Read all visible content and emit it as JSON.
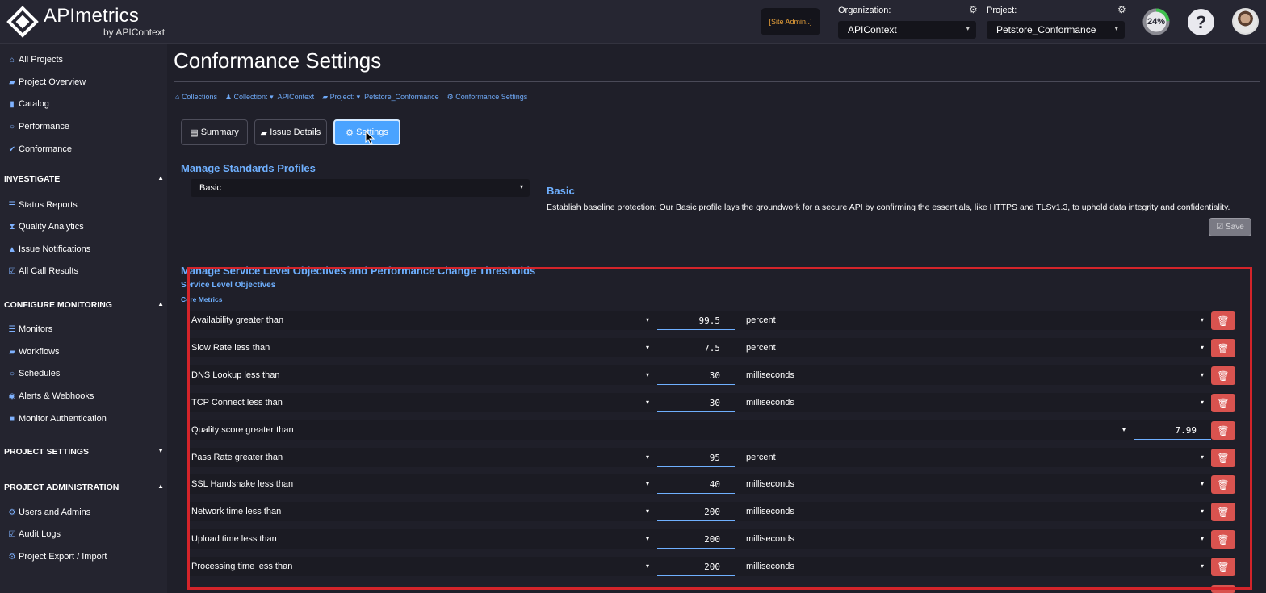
{
  "header": {
    "logo_title": "APImetrics",
    "logo_sub": "by APIContext",
    "site_admin": "[Site Admin..]",
    "org_label": "Organization:",
    "org_value": "APIContext",
    "project_label": "Project:",
    "project_value": "Petstore_Conformance",
    "progress": "24%",
    "help": "?"
  },
  "sidebar": {
    "top_items": [
      {
        "label": "All Projects",
        "icon": "home-icon"
      },
      {
        "label": "Project Overview",
        "icon": "folder-open-icon"
      },
      {
        "label": "Catalog",
        "icon": "book-icon"
      },
      {
        "label": "Performance",
        "icon": "clock-icon"
      },
      {
        "label": "Conformance",
        "icon": "check-icon"
      }
    ],
    "investigate": {
      "heading": "INVESTIGATE",
      "items": [
        {
          "label": "Status Reports",
          "icon": "list-icon"
        },
        {
          "label": "Quality Analytics",
          "icon": "hourglass-icon"
        },
        {
          "label": "Issue Notifications",
          "icon": "bell-icon"
        },
        {
          "label": "All Call Results",
          "icon": "checkbox-icon"
        }
      ]
    },
    "configure": {
      "heading": "CONFIGURE MONITORING",
      "items": [
        {
          "label": "Monitors",
          "icon": "list-icon"
        },
        {
          "label": "Workflows",
          "icon": "folder-icon"
        },
        {
          "label": "Schedules",
          "icon": "clock-icon"
        },
        {
          "label": "Alerts & Webhooks",
          "icon": "globe-icon"
        },
        {
          "label": "Monitor Authentication",
          "icon": "lock-icon"
        }
      ]
    },
    "project_settings": {
      "heading": "PROJECT SETTINGS"
    },
    "administration": {
      "heading": "PROJECT ADMINISTRATION",
      "items": [
        {
          "label": "Users and Admins",
          "icon": "gear-icon"
        },
        {
          "label": "Audit Logs",
          "icon": "checkbox-icon"
        },
        {
          "label": "Project Export / Import",
          "icon": "gear-icon"
        }
      ]
    }
  },
  "main": {
    "title": "Conformance Settings",
    "breadcrumb": [
      "Collections",
      "Collection:",
      "APIContext",
      "Project:",
      "Petstore_Conformance",
      "Conformance Settings"
    ],
    "tabs": [
      "Summary",
      "Issue Details",
      "Settings"
    ],
    "standards": {
      "heading": "Manage Standards Profiles",
      "selected": "Basic",
      "profile_title": "Basic",
      "profile_desc": "Establish baseline protection: Our Basic profile lays the groundwork for a secure API by confirming the essentials, like HTTPS and TLSv1.3, to uphold data integrity and confidentiality.",
      "save_label": "Save"
    },
    "slo": {
      "heading": "Manage Service Level Objectives and Performance Change Thresholds",
      "subheading": "Service Level Objectives",
      "core_label": "Core Metrics",
      "rows": [
        {
          "label": "Availability greater than",
          "value": "99.5",
          "unit": "percent"
        },
        {
          "label": "Slow Rate less than",
          "value": "7.5",
          "unit": "percent"
        },
        {
          "label": "DNS Lookup less than",
          "value": "30",
          "unit": "milliseconds"
        },
        {
          "label": "TCP Connect less than",
          "value": "30",
          "unit": "milliseconds"
        },
        {
          "label": "Quality score greater than",
          "value": "7.99",
          "unit": ""
        },
        {
          "label": "Pass Rate greater than",
          "value": "95",
          "unit": "percent"
        },
        {
          "label": "SSL Handshake less than",
          "value": "40",
          "unit": "milliseconds"
        },
        {
          "label": "Network time less than",
          "value": "200",
          "unit": "milliseconds"
        },
        {
          "label": "Upload time less than",
          "value": "200",
          "unit": "milliseconds"
        },
        {
          "label": "Processing time less than",
          "value": "200",
          "unit": "milliseconds"
        }
      ]
    }
  },
  "colors": {
    "accent": "#4aa3ff",
    "link": "#6fb0ff",
    "delete": "#d9534f",
    "highlight": "#d4242a",
    "admin": "#e8a13a"
  }
}
